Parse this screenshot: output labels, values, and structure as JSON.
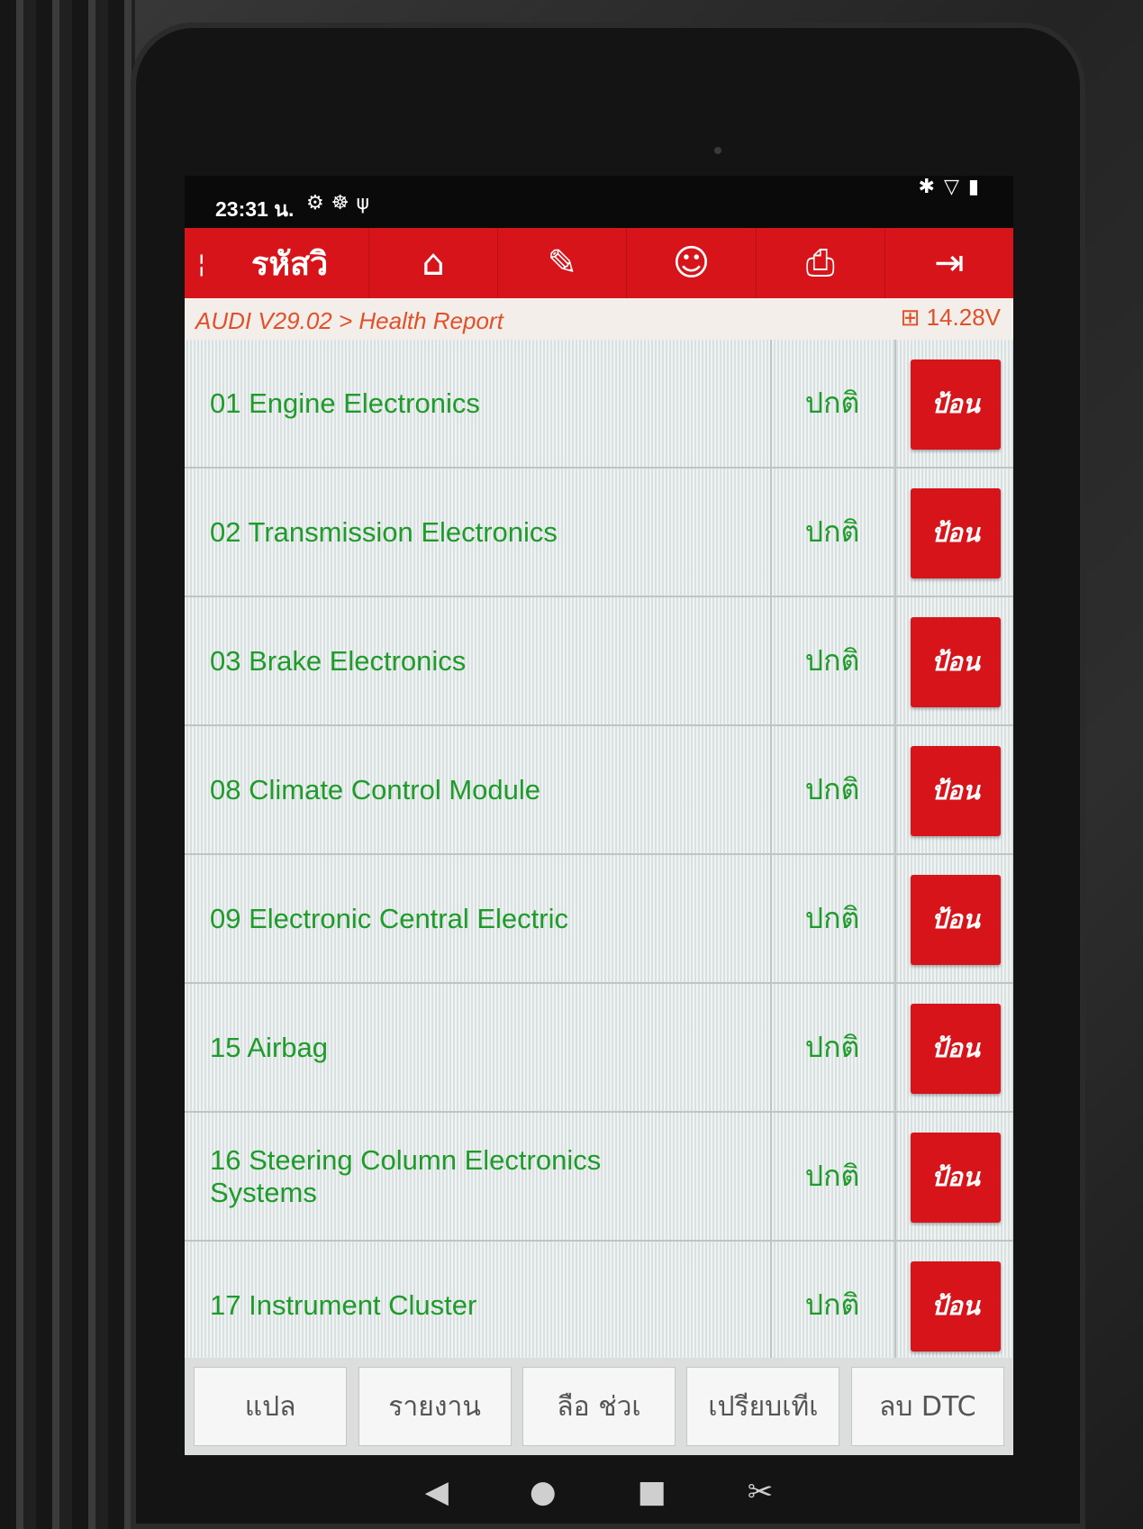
{
  "statusbar": {
    "time": "23:31 น.",
    "left_icons": [
      "gear-icon",
      "accessibility-icon",
      "usb-icon"
    ],
    "right_icons": [
      "bluetooth-icon",
      "wifi-icon",
      "battery-icon"
    ]
  },
  "topbar": {
    "title": "รหัสวิ",
    "buttons": [
      "home-icon",
      "edit-icon",
      "support-icon",
      "print-icon",
      "exit-icon"
    ]
  },
  "breadcrumb": "AUDI V29.02 > Health Report",
  "voltage": "14.28V",
  "rows": [
    {
      "name": "01 Engine Electronics",
      "status": "ปกติ",
      "button": "ป้อน"
    },
    {
      "name": "02 Transmission Electronics",
      "status": "ปกติ",
      "button": "ป้อน"
    },
    {
      "name": "03 Brake Electronics",
      "status": "ปกติ",
      "button": "ป้อน"
    },
    {
      "name": "08 Climate Control Module",
      "status": "ปกติ",
      "button": "ป้อน"
    },
    {
      "name": "09 Electronic Central Electric",
      "status": "ปกติ",
      "button": "ป้อน"
    },
    {
      "name": "15 Airbag",
      "status": "ปกติ",
      "button": "ป้อน"
    },
    {
      "name": "16 Steering Column Electronics Systems",
      "status": "ปกติ",
      "button": "ป้อน"
    },
    {
      "name": "17 Instrument Cluster",
      "status": "ปกติ",
      "button": "ป้อน"
    }
  ],
  "bottom_buttons": [
    "แปล",
    "รายงาน",
    "ลือ ช่วเ",
    "เปรียบเทีเ",
    "ลบ DTC"
  ],
  "colors": {
    "accent": "#d8141b",
    "ok_text": "#1e9b2a",
    "breadcrumb": "#e2502a"
  }
}
